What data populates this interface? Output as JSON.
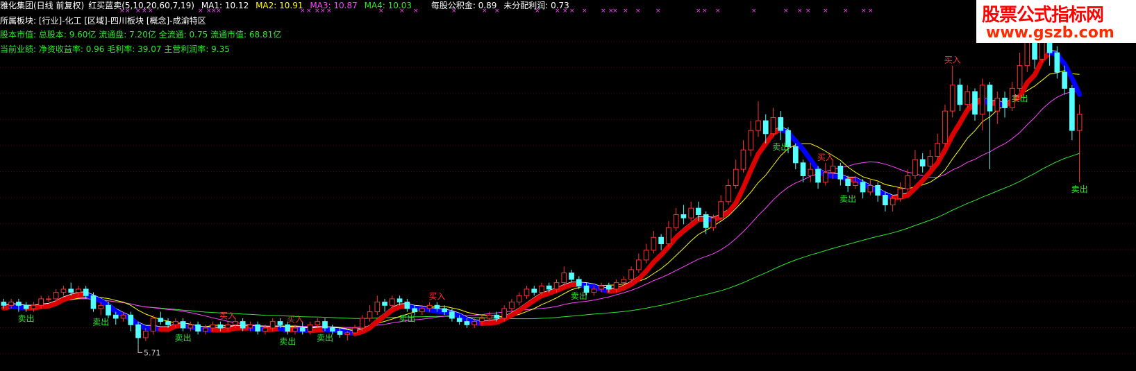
{
  "colors": {
    "background": "#000000",
    "up_candle": "#ff3232",
    "down_candle": "#54ffff",
    "ma1": "#ffffff",
    "ma2": "#ffff00",
    "ma3": "#ff44ff",
    "ma4": "#30e830",
    "trend_up": "#dd0000",
    "trend_down": "#0000ff",
    "grid": "#5a0000",
    "buy_text": "#ff3232",
    "sell_text": "#30e830"
  },
  "header": {
    "title": "雅化集团(日线 前复权)",
    "indicator_name": "红买蓝卖(5,10,20,60,7,19)",
    "ma1_label": "MA1: 10.12",
    "ma2_label": "MA2: 10.91",
    "ma3_label": "MA3: 10.87",
    "ma4_label": "MA4: 10.03",
    "reserve_per_share": "每股公积金: 0.89",
    "undistributed_profit": "未分配利润: 0.73"
  },
  "info": {
    "sector": "所属板块: [行业]-化工 [区域]-四川板块 [概念]-成渝特区",
    "capital": "股本市值: 总股本: 9.60亿 流通盘: 7.20亿 全流通: 0.75 流通市值: 68.81亿",
    "performance": "当前业绩: 净资收益率: 0.96 毛利率: 39.07 主营利润率: 9.35"
  },
  "watermark": {
    "title": "股票公式指标网",
    "url": "www.gszb.com"
  },
  "signals": {
    "buy": "买入",
    "sell": "卖出"
  },
  "low_label": "5.71",
  "chart_data": {
    "type": "candlestick",
    "title": "雅化集团(日线 前复权)",
    "y_range": [
      5.2,
      15.8
    ],
    "lowest_marked": 5.71,
    "candles": [
      [
        6.9,
        6.8,
        7.0,
        6.7
      ],
      [
        6.8,
        6.9,
        7.0,
        6.7
      ],
      [
        6.9,
        6.8,
        7.0,
        6.6
      ],
      [
        6.8,
        6.7,
        6.9,
        6.6
      ],
      [
        6.7,
        6.8,
        6.9,
        6.6
      ],
      [
        6.8,
        7.0,
        7.1,
        6.7
      ],
      [
        7.0,
        7.0,
        7.1,
        6.9
      ],
      [
        7.0,
        7.2,
        7.3,
        6.9
      ],
      [
        7.2,
        7.3,
        7.4,
        7.1
      ],
      [
        7.3,
        7.2,
        7.5,
        7.1
      ],
      [
        7.2,
        7.3,
        7.4,
        7.1
      ],
      [
        7.3,
        7.1,
        7.4,
        7.0
      ],
      [
        7.1,
        6.7,
        7.2,
        6.6
      ],
      [
        6.7,
        6.8,
        6.9,
        6.5
      ],
      [
        6.8,
        6.5,
        6.9,
        6.4
      ],
      [
        6.5,
        6.4,
        6.6,
        6.2
      ],
      [
        6.4,
        6.5,
        6.6,
        6.3
      ],
      [
        6.5,
        6.2,
        6.6,
        6.0
      ],
      [
        6.2,
        5.8,
        6.3,
        5.6
      ],
      [
        5.8,
        6.0,
        6.1,
        5.7
      ],
      [
        6.0,
        6.4,
        6.5,
        5.9
      ],
      [
        6.4,
        6.3,
        6.6,
        6.2
      ],
      [
        6.3,
        6.2,
        6.4,
        6.1
      ],
      [
        6.2,
        6.3,
        6.4,
        6.1
      ],
      [
        6.3,
        6.1,
        6.4,
        6.0
      ],
      [
        6.1,
        6.2,
        6.3,
        6.0
      ],
      [
        6.2,
        6.0,
        6.3,
        5.9
      ],
      [
        6.0,
        6.1,
        6.2,
        5.9
      ],
      [
        6.1,
        6.2,
        6.3,
        6.0
      ],
      [
        6.2,
        6.1,
        6.3,
        6.0
      ],
      [
        6.1,
        6.2,
        6.3,
        6.0
      ],
      [
        6.2,
        6.3,
        6.4,
        6.1
      ],
      [
        6.3,
        6.1,
        6.4,
        6.0
      ],
      [
        6.1,
        6.2,
        6.3,
        6.0
      ],
      [
        6.2,
        6.0,
        6.3,
        5.9
      ],
      [
        6.0,
        6.1,
        6.2,
        5.9
      ],
      [
        6.1,
        6.3,
        6.4,
        6.0
      ],
      [
        6.3,
        6.2,
        6.4,
        6.1
      ],
      [
        6.2,
        6.0,
        6.3,
        5.9
      ],
      [
        6.0,
        6.1,
        6.2,
        5.9
      ],
      [
        6.1,
        6.0,
        6.3,
        5.9
      ],
      [
        6.0,
        6.2,
        6.3,
        5.9
      ],
      [
        6.2,
        6.3,
        6.4,
        6.1
      ],
      [
        6.3,
        6.1,
        6.4,
        6.0
      ],
      [
        6.1,
        6.0,
        6.2,
        5.9
      ],
      [
        6.0,
        5.9,
        6.1,
        5.8
      ],
      [
        5.9,
        5.95,
        6.0,
        5.71
      ],
      [
        5.95,
        6.1,
        6.2,
        5.9
      ],
      [
        6.1,
        6.4,
        6.5,
        6.0
      ],
      [
        6.4,
        6.6,
        6.8,
        6.3
      ],
      [
        6.6,
        6.9,
        7.1,
        6.5
      ],
      [
        6.9,
        6.8,
        7.0,
        6.6
      ],
      [
        6.8,
        7.0,
        7.1,
        6.7
      ],
      [
        7.0,
        6.9,
        7.1,
        6.8
      ],
      [
        6.9,
        6.7,
        7.0,
        6.6
      ],
      [
        6.7,
        6.6,
        6.8,
        6.5
      ],
      [
        6.6,
        6.7,
        6.8,
        6.5
      ],
      [
        6.7,
        6.8,
        6.9,
        6.6
      ],
      [
        6.8,
        6.7,
        6.9,
        6.6
      ],
      [
        6.7,
        6.6,
        6.8,
        6.5
      ],
      [
        6.6,
        6.4,
        6.7,
        6.3
      ],
      [
        6.4,
        6.3,
        6.5,
        6.2
      ],
      [
        6.3,
        6.2,
        6.4,
        6.1
      ],
      [
        6.2,
        6.3,
        6.4,
        6.1
      ],
      [
        6.3,
        6.4,
        6.5,
        6.2
      ],
      [
        6.4,
        6.5,
        6.6,
        6.3
      ],
      [
        6.5,
        6.4,
        6.6,
        6.3
      ],
      [
        6.4,
        6.7,
        6.8,
        6.3
      ],
      [
        6.7,
        6.9,
        7.0,
        6.6
      ],
      [
        6.9,
        7.1,
        7.2,
        6.8
      ],
      [
        7.1,
        7.3,
        7.4,
        7.0
      ],
      [
        7.3,
        7.2,
        7.4,
        7.1
      ],
      [
        7.2,
        7.4,
        7.5,
        7.1
      ],
      [
        7.4,
        7.3,
        7.5,
        7.2
      ],
      [
        7.3,
        7.5,
        7.6,
        7.2
      ],
      [
        7.5,
        7.8,
        8.0,
        7.4
      ],
      [
        7.8,
        7.6,
        7.9,
        7.5
      ],
      [
        7.6,
        7.4,
        7.7,
        7.3
      ],
      [
        7.4,
        7.2,
        7.5,
        7.1
      ],
      [
        7.2,
        7.3,
        7.4,
        7.1
      ],
      [
        7.3,
        7.4,
        7.5,
        7.2
      ],
      [
        7.4,
        7.3,
        7.5,
        7.2
      ],
      [
        7.3,
        7.5,
        7.6,
        7.2
      ],
      [
        7.5,
        7.6,
        7.7,
        7.4
      ],
      [
        7.6,
        7.9,
        8.0,
        7.5
      ],
      [
        7.9,
        8.2,
        8.4,
        7.8
      ],
      [
        8.2,
        8.5,
        8.7,
        8.1
      ],
      [
        8.5,
        8.9,
        9.1,
        8.4
      ],
      [
        8.9,
        8.7,
        9.0,
        8.5
      ],
      [
        8.7,
        9.2,
        9.4,
        8.6
      ],
      [
        9.2,
        9.6,
        9.8,
        9.1
      ],
      [
        9.6,
        9.5,
        9.9,
        9.3
      ],
      [
        9.5,
        9.8,
        10.0,
        9.4
      ],
      [
        9.8,
        9.6,
        10.0,
        9.4
      ],
      [
        9.6,
        9.2,
        9.7,
        9.0
      ],
      [
        9.2,
        9.5,
        9.6,
        9.1
      ],
      [
        9.5,
        10.0,
        10.2,
        9.4
      ],
      [
        10.0,
        10.5,
        10.7,
        9.9
      ],
      [
        10.5,
        11.0,
        11.3,
        10.4
      ],
      [
        11.0,
        11.6,
        11.9,
        10.9
      ],
      [
        11.6,
        12.2,
        12.5,
        11.4
      ],
      [
        12.2,
        12.5,
        13.1,
        12.0
      ],
      [
        12.5,
        12.1,
        12.7,
        11.8
      ],
      [
        12.1,
        12.6,
        12.9,
        12.0
      ],
      [
        12.6,
        12.2,
        12.8,
        11.9
      ],
      [
        12.2,
        11.7,
        12.3,
        11.5
      ],
      [
        11.7,
        11.2,
        11.8,
        11.0
      ],
      [
        11.2,
        10.8,
        11.3,
        10.6
      ],
      [
        10.8,
        11.0,
        11.2,
        10.6
      ],
      [
        11.0,
        10.6,
        11.1,
        10.4
      ],
      [
        10.6,
        10.9,
        11.2,
        10.5
      ],
      [
        10.9,
        11.1,
        11.3,
        10.7
      ],
      [
        11.1,
        10.7,
        11.2,
        10.5
      ],
      [
        10.7,
        10.5,
        10.8,
        10.3
      ],
      [
        10.5,
        10.6,
        10.8,
        10.4
      ],
      [
        10.6,
        10.3,
        10.7,
        10.1
      ],
      [
        10.3,
        10.5,
        10.7,
        10.2
      ],
      [
        10.5,
        10.2,
        10.6,
        10.0
      ],
      [
        10.2,
        9.9,
        10.3,
        9.7
      ],
      [
        9.9,
        10.1,
        10.2,
        9.7
      ],
      [
        10.1,
        10.4,
        10.6,
        10.0
      ],
      [
        10.4,
        10.8,
        11.0,
        10.3
      ],
      [
        10.8,
        11.3,
        11.6,
        10.7
      ],
      [
        11.3,
        11.1,
        11.5,
        10.9
      ],
      [
        11.1,
        11.4,
        11.6,
        11.0
      ],
      [
        11.4,
        11.8,
        12.1,
        11.3
      ],
      [
        11.8,
        12.8,
        13.0,
        11.7
      ],
      [
        12.8,
        13.6,
        14.2,
        12.6
      ],
      [
        13.6,
        13.0,
        13.8,
        12.8
      ],
      [
        13.0,
        13.4,
        13.6,
        12.9
      ],
      [
        13.4,
        12.7,
        13.5,
        12.5
      ],
      [
        12.7,
        13.6,
        13.8,
        12.2
      ],
      [
        13.6,
        12.8,
        13.7,
        11.0
      ],
      [
        12.8,
        13.2,
        13.4,
        12.4
      ],
      [
        13.2,
        12.9,
        13.4,
        12.6
      ],
      [
        12.9,
        13.5,
        13.7,
        12.8
      ],
      [
        13.5,
        14.2,
        14.6,
        13.4
      ],
      [
        14.2,
        15.0,
        15.2,
        14.0
      ],
      [
        15.0,
        14.4,
        15.2,
        14.1
      ],
      [
        14.4,
        15.2,
        15.4,
        14.3
      ],
      [
        15.2,
        14.6,
        15.5,
        14.2
      ],
      [
        14.6,
        14.0,
        14.8,
        13.8
      ],
      [
        14.0,
        13.5,
        14.2,
        13.3
      ],
      [
        13.5,
        12.2,
        13.6,
        11.9
      ],
      [
        12.2,
        12.7,
        13.0,
        10.6
      ]
    ],
    "ma_lines": [
      {
        "name": "MA1",
        "period": 5,
        "color": "#ffffff"
      },
      {
        "name": "MA2",
        "period": 10,
        "color": "#ffff00"
      },
      {
        "name": "MA3",
        "period": 20,
        "color": "#ff44ff"
      },
      {
        "name": "MA4",
        "period": 60,
        "color": "#30e830"
      }
    ],
    "buy_signals": [
      30,
      39,
      58,
      110,
      127,
      140
    ],
    "sell_signals": [
      3,
      13,
      24,
      38,
      43,
      54,
      77,
      104,
      113,
      136,
      144
    ]
  }
}
